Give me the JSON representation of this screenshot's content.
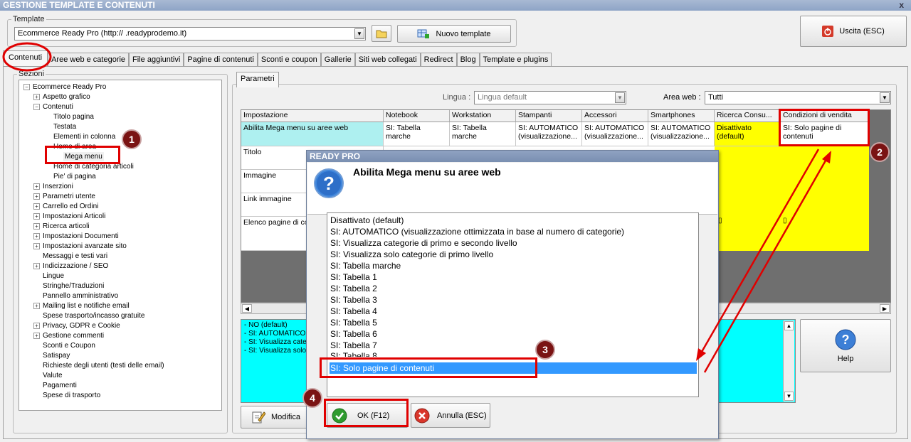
{
  "window": {
    "title": "GESTIONE TEMPLATE E CONTENUTI",
    "close": "x"
  },
  "template": {
    "group_label": "Template",
    "selected": "Ecommerce Ready Pro (http://         .readyprodemo.it)",
    "new_button": "Nuovo template"
  },
  "exit_button": "Uscita (ESC)",
  "tabs": [
    "Contenuti",
    "Aree web e categorie",
    "File aggiuntivi",
    "Pagine di contenuti",
    "Sconti e coupon",
    "Gallerie",
    "Siti web collegati",
    "Redirect",
    "Blog",
    "Template e plugins"
  ],
  "sections": {
    "label": "Sezioni",
    "nodes": [
      {
        "label": "Ecommerce Ready Pro",
        "sign": "−"
      },
      {
        "label": "Aspetto grafico",
        "sign": "+"
      },
      {
        "label": "Contenuti",
        "sign": "−"
      },
      {
        "label": "Titolo pagina",
        "sign": ""
      },
      {
        "label": "Testata",
        "sign": ""
      },
      {
        "label": "Elementi in colonna",
        "sign": ""
      },
      {
        "label": "Home di area",
        "sign": ""
      },
      {
        "label": "Mega menu",
        "sign": ""
      },
      {
        "label": "Home di categoria articoli",
        "sign": ""
      },
      {
        "label": "Pie' di pagina",
        "sign": ""
      },
      {
        "label": "Inserzioni",
        "sign": "+"
      },
      {
        "label": "Parametri utente",
        "sign": "+"
      },
      {
        "label": "Carrello ed Ordini",
        "sign": "+"
      },
      {
        "label": "Impostazioni Articoli",
        "sign": "+"
      },
      {
        "label": "Ricerca articoli",
        "sign": "+"
      },
      {
        "label": "Impostazioni Documenti",
        "sign": "+"
      },
      {
        "label": "Impostazioni avanzate sito",
        "sign": "+"
      },
      {
        "label": "Messaggi e testi vari",
        "sign": ""
      },
      {
        "label": "Indicizzazione / SEO",
        "sign": "+"
      },
      {
        "label": "Lingue",
        "sign": ""
      },
      {
        "label": "Stringhe/Traduzioni",
        "sign": ""
      },
      {
        "label": "Pannello amministrativo",
        "sign": ""
      },
      {
        "label": "Mailing list e notifiche email",
        "sign": "+"
      },
      {
        "label": "Spese trasporto/incasso gratuite",
        "sign": ""
      },
      {
        "label": "Privacy, GDPR e Cookie",
        "sign": "+"
      },
      {
        "label": "Gestione commenti",
        "sign": "+"
      },
      {
        "label": "Sconti e Coupon",
        "sign": ""
      },
      {
        "label": "Satispay",
        "sign": ""
      },
      {
        "label": "Richieste degli utenti (testi delle email)",
        "sign": ""
      },
      {
        "label": "Valute",
        "sign": ""
      },
      {
        "label": "Pagamenti",
        "sign": ""
      },
      {
        "label": "Spese di trasporto",
        "sign": ""
      }
    ]
  },
  "params": {
    "tab": "Parametri",
    "lingua_label": "Lingua :",
    "lingua_value": "Lingua default",
    "area_label": "Area web :",
    "area_value": "Tutti"
  },
  "grid": {
    "headers": [
      "Impostazione",
      "Notebook",
      "Workstation",
      "Stampanti",
      "Accessori",
      "Smartphones",
      "Ricerca Consu...",
      "Condizioni di vendita"
    ],
    "row0": [
      "Abilita Mega menu su aree web",
      "SI: Tabella marche",
      "SI: Tabella marche",
      "SI: AUTOMATICO (visualizzazione...",
      "SI: AUTOMATICO (visualizzazione...",
      "SI: AUTOMATICO (visualizzazione...",
      "Disattivato (default)",
      "SI: Solo pagine di contenuti"
    ],
    "rows": [
      "Titolo",
      "Immagine",
      "Link immagine",
      "Elenco pagine di co"
    ]
  },
  "info_lines": [
    "- NO (default)",
    "- SI: AUTOMATICO",
    "- SI: Visualizza categ",
    "- SI: Visualizza solo"
  ],
  "modify_button": "Modifica",
  "help_button": "Help",
  "dialog": {
    "title": "READY PRO",
    "heading": "Abilita Mega menu su aree web",
    "options": [
      "Disattivato (default)",
      "SI: AUTOMATICO (visualizzazione ottimizzata in base al numero di categorie)",
      "SI: Visualizza categorie di primo e secondo livello",
      "SI: Visualizza solo categorie di primo livello",
      "SI: Tabella marche",
      "SI: Tabella 1",
      "SI: Tabella 2",
      "SI: Tabella 3",
      "SI: Tabella 4",
      "SI: Tabella 5",
      "SI: Tabella 6",
      "SI: Tabella 7",
      "SI: Tabella 8",
      "SI: Solo pagine di contenuti"
    ],
    "ok": "OK (F12)",
    "cancel": "Annulla (ESC)"
  },
  "badges": [
    "1",
    "2",
    "3",
    "4"
  ],
  "colors": {
    "accent_red": "#e00000",
    "cyan": "#00ffff",
    "yellow": "#ffff00",
    "selection": "#3399ff"
  }
}
